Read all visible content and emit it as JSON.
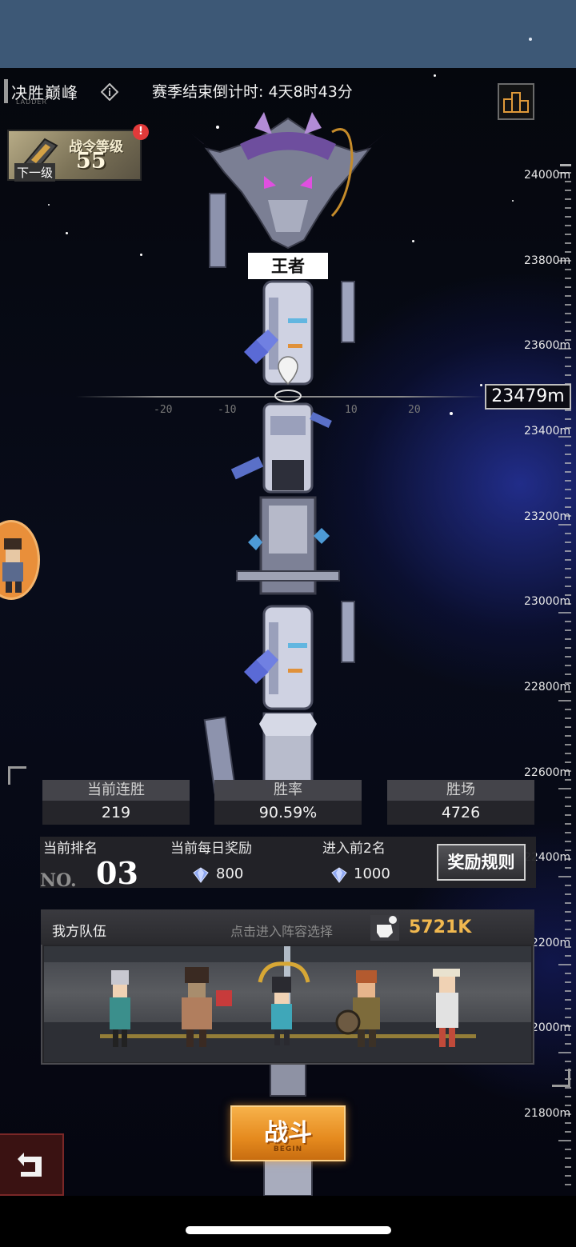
{
  "header": {
    "title": "决胜巅峰",
    "title_sub": "LADDER",
    "countdown": "赛季结束倒计时:  4天8时43分"
  },
  "battle_pass": {
    "title": "战令等级",
    "level": "55",
    "next_label": "下一级",
    "alert": "!"
  },
  "altitude": {
    "current": "23479m",
    "marks": [
      "24000m",
      "23800m",
      "23600m",
      "23400m",
      "23200m",
      "23000m",
      "22800m",
      "22600m",
      "22400m",
      "22200m",
      "22000m",
      "21800m"
    ],
    "offset_ticks": [
      "-20",
      "-10",
      "10",
      "20"
    ]
  },
  "tier": {
    "rank_name": "王者"
  },
  "stats": [
    {
      "label": "当前连胜",
      "value": "219"
    },
    {
      "label": "胜率",
      "value": "90.59%"
    },
    {
      "label": "胜场",
      "value": "4726"
    }
  ],
  "ranking": {
    "label": "当前排名",
    "no_prefix": "NO.",
    "rank": "03",
    "daily_reward_label": "当前每日奖励",
    "daily_reward_value": "800",
    "top2_label": "进入前2名",
    "top2_value": "1000",
    "rules_button": "奖励规则"
  },
  "team": {
    "title": "我方队伍",
    "hint": "点击进入阵容选择",
    "power": "5721K",
    "power_badge": "!"
  },
  "fight_button": {
    "label": "战斗",
    "sub": "BEGIN"
  },
  "icons": {
    "info": "info-icon",
    "podium": "podium-icon",
    "gem": "gem-icon",
    "fist": "fist-icon",
    "back": "back-arrow-icon"
  },
  "colors": {
    "accent_orange": "#e58a1e",
    "power_gold": "#f1b84f",
    "alert_red": "#e23a3a",
    "status_bar": "#3d5876"
  }
}
